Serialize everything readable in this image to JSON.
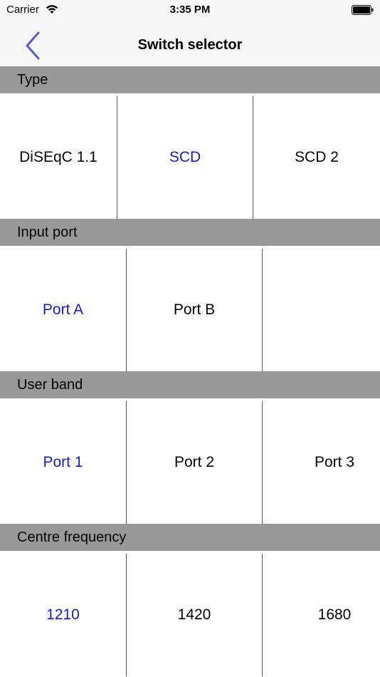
{
  "status_bar": {
    "carrier": "Carrier",
    "time": "3:35 PM"
  },
  "nav": {
    "title": "Switch selector",
    "back_icon": "chevron-left-icon",
    "accent_color": "#5a5ad8"
  },
  "sections": [
    {
      "header": "Type",
      "options": [
        "DiSEqC 1.1",
        "SCD",
        "SCD 2"
      ],
      "selected_index": 1
    },
    {
      "header": "Input port",
      "options": [
        "Port A",
        "Port B",
        ""
      ],
      "selected_index": 0
    },
    {
      "header": "User band",
      "options": [
        "Port 1",
        "Port 2",
        "Port 3"
      ],
      "selected_index": 0
    },
    {
      "header": "Centre frequency",
      "options": [
        "1210",
        "1420",
        "1680"
      ],
      "selected_index": 0
    }
  ],
  "colors": {
    "selected_text": "#1a1ad6",
    "section_header_bg": "#999999"
  }
}
